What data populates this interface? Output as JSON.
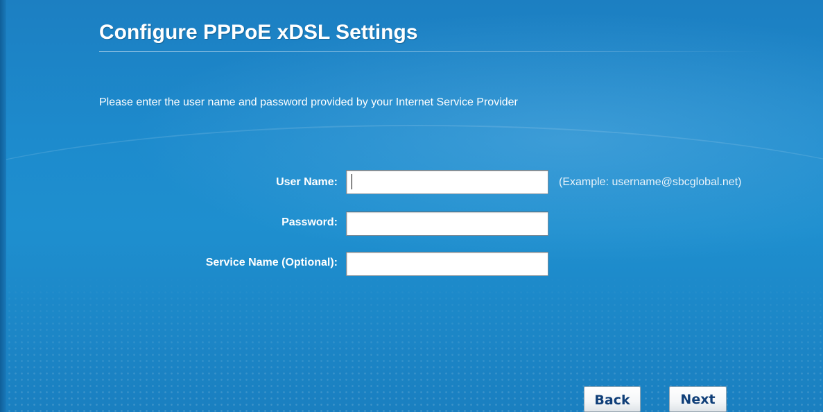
{
  "page": {
    "title": "Configure PPPoE xDSL Settings",
    "instruction": "Please enter the user name and password provided by your Internet Service Provider"
  },
  "form": {
    "user_name": {
      "label": "User Name:",
      "value": "",
      "example": "(Example: username@sbcglobal.net)"
    },
    "password": {
      "label": "Password:",
      "value": ""
    },
    "service_name": {
      "label": "Service Name (Optional):",
      "value": ""
    }
  },
  "buttons": {
    "back_label": "Back",
    "next_label": "Next"
  },
  "colors": {
    "background": "#1d8bcd",
    "text": "#ffffff",
    "button_text": "#0f3e78"
  }
}
